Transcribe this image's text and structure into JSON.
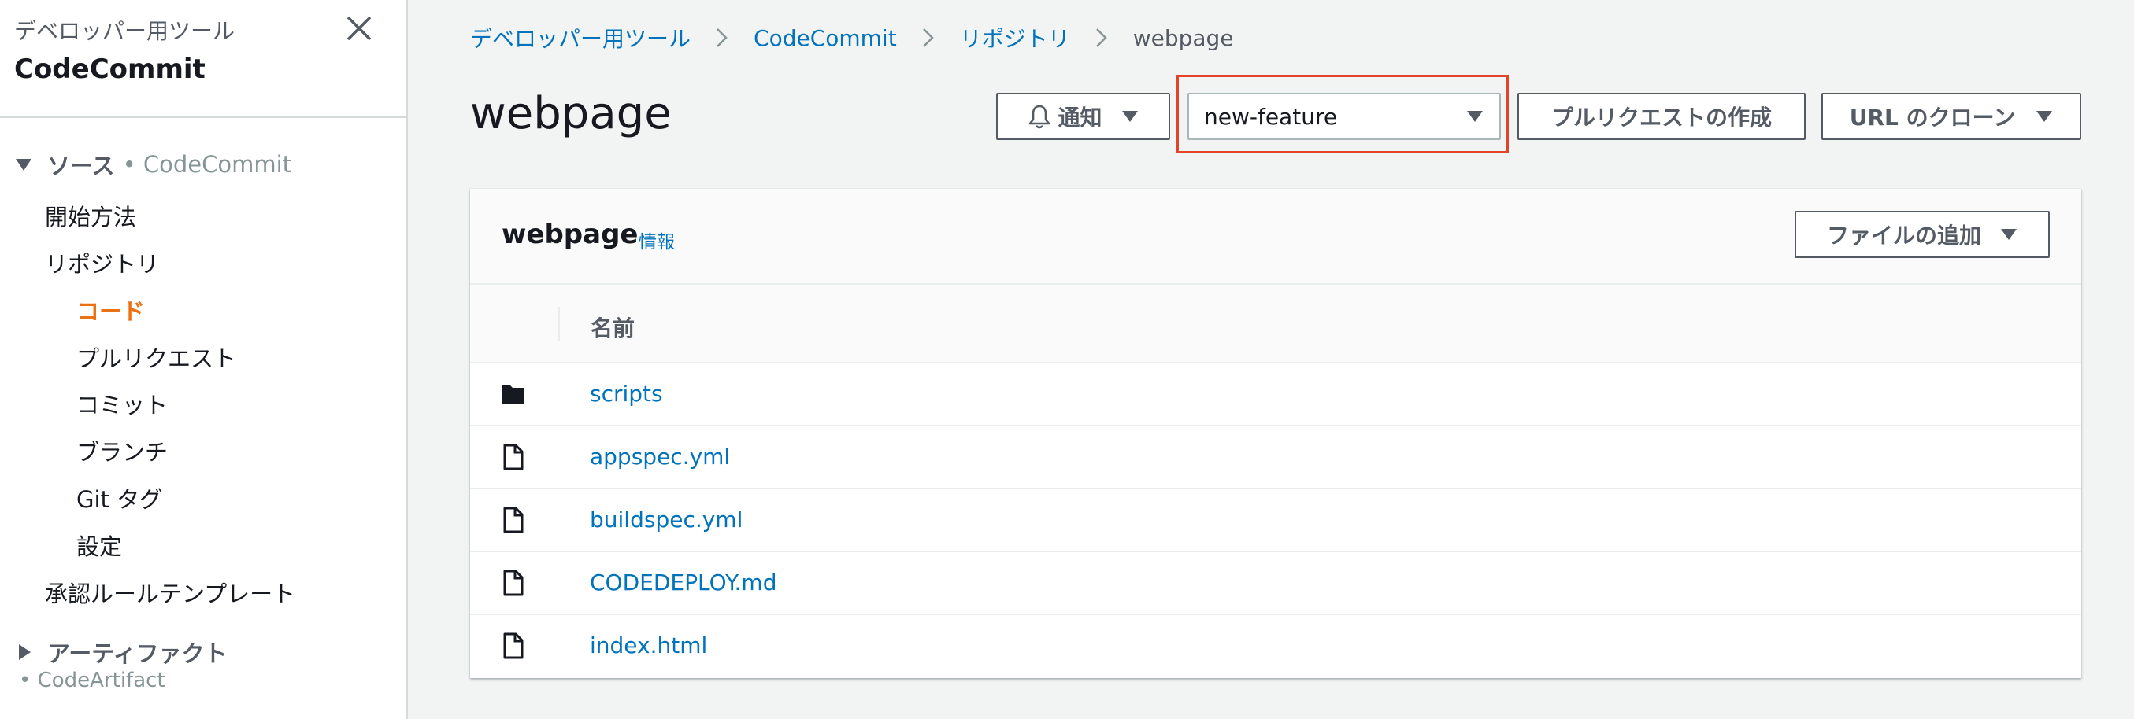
{
  "sidebar": {
    "super_title": "デベロッパー用ツール",
    "title": "CodeCommit",
    "sections": [
      {
        "label": "ソース",
        "sub": "• CodeCommit",
        "expanded": true
      },
      {
        "label": "アーティファクト",
        "sub": "• CodeArtifact",
        "expanded": false
      }
    ],
    "items": [
      "開始方法",
      "リポジトリ",
      "コード",
      "プルリクエスト",
      "コミット",
      "ブランチ",
      "Git タグ",
      "設定",
      "承認ルールテンプレート"
    ],
    "active_item": "コード",
    "active_color": "#ec7211"
  },
  "breadcrumb": [
    "デベロッパー用ツール",
    "CodeCommit",
    "リポジトリ",
    "webpage"
  ],
  "page": {
    "title": "webpage",
    "notify_label": "通知",
    "branch": "new-feature",
    "create_pr_label": "プルリクエストの作成",
    "clone_url_label": "URL のクローン"
  },
  "panel": {
    "title": "webpage",
    "info_label": "情報",
    "add_file_label": "ファイルの追加",
    "column_name": "名前",
    "rows": [
      {
        "type": "folder",
        "name": "scripts"
      },
      {
        "type": "file",
        "name": "appspec.yml"
      },
      {
        "type": "file",
        "name": "buildspec.yml"
      },
      {
        "type": "file",
        "name": "CODEDEPLOY.md"
      },
      {
        "type": "file",
        "name": "index.html"
      }
    ]
  },
  "colors": {
    "link": "#0073bb",
    "highlight_border": "#e0452b",
    "background": "#f2f3f3"
  }
}
